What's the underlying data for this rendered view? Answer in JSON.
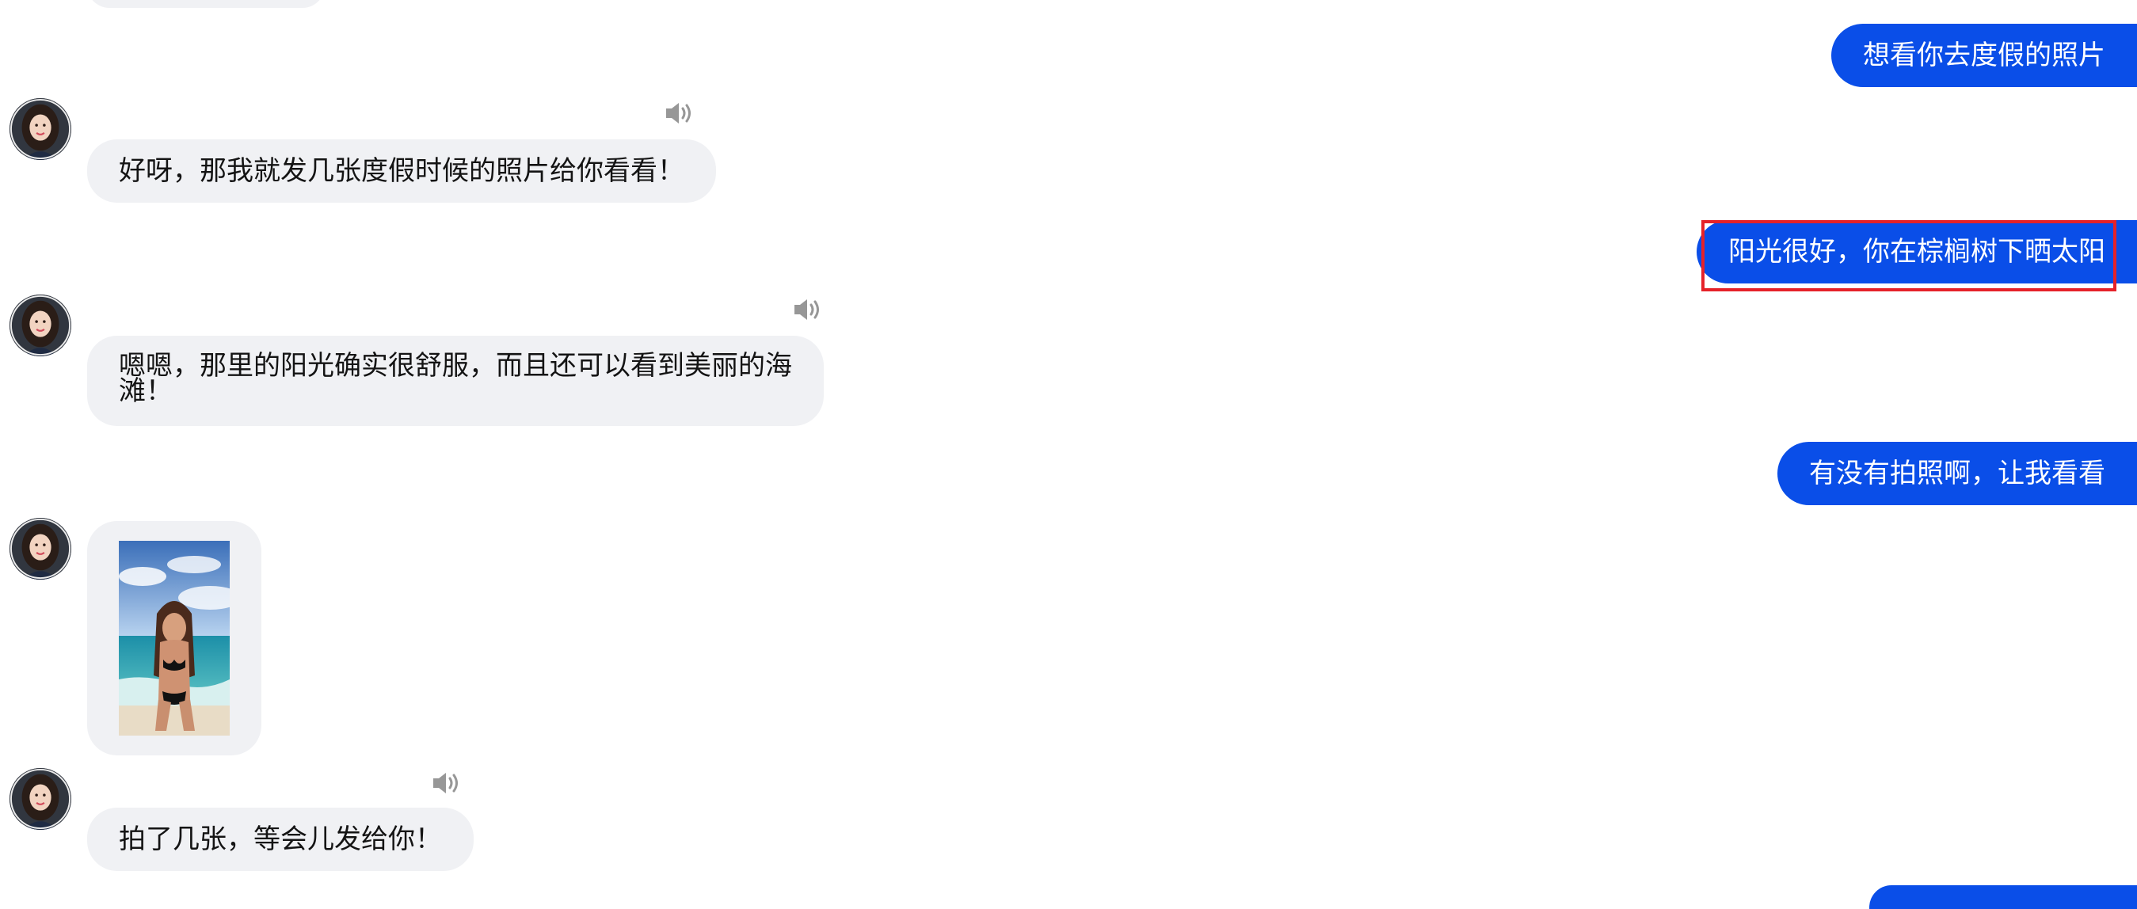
{
  "colors": {
    "incoming_bubble": "#f0f1f4",
    "outgoing_bubble": "#0a4ee8",
    "highlight": "#e52229",
    "text_dark": "#141414",
    "icon_gray": "#8c8c8c"
  },
  "messages": [
    {
      "id": "m1",
      "from": "user",
      "text": "想看你去度假的照片"
    },
    {
      "id": "m2",
      "from": "assistant",
      "text": "好呀，那我就发几张度假时候的照片给你看看！",
      "icon": "speaker-icon"
    },
    {
      "id": "m3",
      "from": "user",
      "text": "阳光很好，你在棕榈树下晒太阳",
      "highlighted": true
    },
    {
      "id": "m4",
      "from": "assistant",
      "text_line1": "嗯嗯，那里的阳光确实很舒服，而且还可以看到美丽的海",
      "text_line2": "滩！",
      "icon": "speaker-icon"
    },
    {
      "id": "m5",
      "from": "user",
      "text": "有没有拍照啊，让我看看"
    },
    {
      "id": "m6",
      "from": "assistant",
      "type": "image",
      "icon": "beach-photo"
    },
    {
      "id": "m7",
      "from": "assistant",
      "text": "拍了几张，等会儿发给你！",
      "icon": "speaker-icon"
    }
  ]
}
